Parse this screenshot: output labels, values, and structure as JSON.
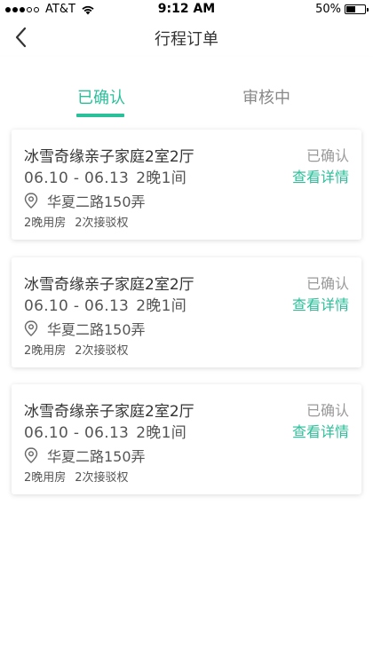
{
  "status_bar": {
    "carrier": "AT&T",
    "time": "9:12 AM",
    "battery_percent": "50%",
    "battery_level": 0.5,
    "signal_bars_filled": 3,
    "signal_bars_total": 5
  },
  "nav": {
    "title": "行程订单",
    "back_icon": "chevron-left-icon"
  },
  "tabs": [
    {
      "label": "已确认",
      "active": true
    },
    {
      "label": "审核中",
      "active": false
    }
  ],
  "accent_color": "#2bbf9a",
  "orders": [
    {
      "title": "冰雪奇缘亲子家庭2室2厅",
      "dates": "06.10 - 06.13",
      "nights": "2晚1间",
      "address": "华夏二路150弄",
      "tag1": "2晚用房",
      "tag2": "2次接驳权",
      "status": "已确认",
      "detail_label": "查看详情"
    },
    {
      "title": "冰雪奇缘亲子家庭2室2厅",
      "dates": "06.10 - 06.13",
      "nights": "2晚1间",
      "address": "华夏二路150弄",
      "tag1": "2晚用房",
      "tag2": "2次接驳权",
      "status": "已确认",
      "detail_label": "查看详情"
    },
    {
      "title": "冰雪奇缘亲子家庭2室2厅",
      "dates": "06.10 - 06.13",
      "nights": "2晚1间",
      "address": "华夏二路150弄",
      "tag1": "2晚用房",
      "tag2": "2次接驳权",
      "status": "已确认",
      "detail_label": "查看详情"
    }
  ]
}
